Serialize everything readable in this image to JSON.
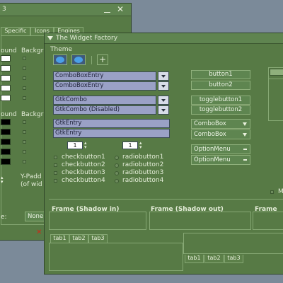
{
  "back_window": {
    "title_fragment": "3",
    "tabs": [
      "Specific",
      "Icons",
      "Engines"
    ],
    "col_foreground": "ound",
    "col_background": "Backgr",
    "col_foreground2": "ound",
    "col_background2": "Backgr",
    "padding_label_1": "Y-Padd",
    "padding_label_2": "(of wid",
    "spin_value": "0",
    "bottom_label": "e:",
    "bottom_value": "None"
  },
  "front_window": {
    "title": "The Widget Factory",
    "theme_label": "Theme",
    "toolbar_plus": "+",
    "combo_entry_1": "ComboBoxEntry",
    "combo_entry_2": "ComboBoxEntry",
    "gtk_combo": "GtkCombo",
    "gtk_combo_disabled": "GtkCombo (Disabled)",
    "gtk_entry_1": "GtkEntry",
    "gtk_entry_2": "GtkEntry",
    "spin_1": "1",
    "spin_2": "1",
    "checkbuttons": [
      "checkbutton1",
      "checkbutton2",
      "checkbutton3",
      "checkbutton4"
    ],
    "radiobuttons": [
      "radiobutton1",
      "radiobutton2",
      "radiobutton3",
      "radiobutton4"
    ],
    "button_1": "button1",
    "button_2": "button2",
    "togglebutton_1": "togglebutton1",
    "togglebutton_2": "togglebutton2",
    "combobox_1": "ComboBox",
    "combobox_2": "ComboBox",
    "optionmenu_1": "OptionMenu",
    "optionmenu_2": "OptionMenu",
    "right_label": "M",
    "frame_shadow_in": "Frame (Shadow in)",
    "frame_shadow_out": "Frame (Shadow out)",
    "frame_cut": "Frame",
    "tabs_top": [
      "tab1",
      "tab2",
      "tab3"
    ],
    "tabs_bottom": [
      "tab1",
      "tab2",
      "tab3"
    ]
  },
  "colors": {
    "window_bg": "#577a45",
    "desktop_bg": "#7b8a99",
    "entry_bg": "#9aa1c6",
    "accent_border": "#8fb07c"
  }
}
